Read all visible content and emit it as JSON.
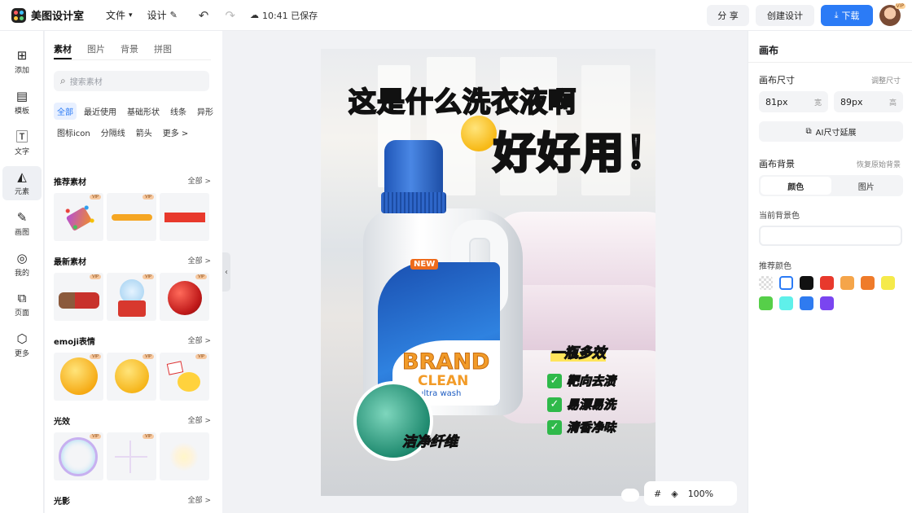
{
  "header": {
    "app_name": "美图设计室",
    "menu_file": "文件",
    "menu_design": "设计",
    "saved_status": "10:41 已保存",
    "share_label": "分 享",
    "create_label": "创建设计",
    "download_label": "下载",
    "avatar_badge": "VIP"
  },
  "rail": {
    "items": [
      {
        "label": "添加",
        "icon": "plus-square-icon"
      },
      {
        "label": "模板",
        "icon": "template-icon"
      },
      {
        "label": "文字",
        "icon": "text-icon"
      },
      {
        "label": "元素",
        "icon": "shapes-icon"
      },
      {
        "label": "画图",
        "icon": "edit-icon"
      },
      {
        "label": "我的",
        "icon": "user-icon"
      },
      {
        "label": "页面",
        "icon": "add-page-icon"
      },
      {
        "label": "更多",
        "icon": "cube-icon"
      }
    ],
    "active_index": 3
  },
  "panel": {
    "tabs": [
      "素材",
      "图片",
      "背景",
      "拼图"
    ],
    "search_placeholder": "搜索素材",
    "chips": [
      "全部",
      "最近使用",
      "基础形状",
      "线条",
      "异形",
      "图标icon",
      "分隔线",
      "箭头",
      "更多 >"
    ],
    "sections": [
      {
        "title": "推荐素材",
        "more": "全部 >"
      },
      {
        "title": "最新素材",
        "more": "全部 >"
      },
      {
        "title": "emoji表情",
        "more": "全部 >"
      },
      {
        "title": "光效",
        "more": "全部 >"
      },
      {
        "title": "光影",
        "more": "全部 >"
      }
    ],
    "vip_badge": "VIP"
  },
  "poster": {
    "headline": "这是什么洗衣液啊",
    "subheadline": "好好用！",
    "new_tag": "NEW",
    "brand": "BRAND",
    "clean": "CLEAN",
    "ultra": "ultra wash",
    "fiber_label": "洁净纤维",
    "multi_effect": "一瓶多效",
    "features": [
      "靶向去渍",
      "易漂易洗",
      "清香净味"
    ]
  },
  "zoom": {
    "grid_icon": "#",
    "level": "100%"
  },
  "right_panel": {
    "title": "画布",
    "size_label": "画布尺寸",
    "resize_link": "调整尺寸",
    "width_value": "81px",
    "width_unit": "宽",
    "height_value": "89px",
    "height_unit": "高",
    "ai_extend": "AI尺寸延展",
    "bg_label": "画布背景",
    "restore_link": "恢复原始背景",
    "seg_color": "颜色",
    "seg_image": "图片",
    "current_bg": "当前背景色",
    "recommended": "推荐颜色",
    "swatch_colors": [
      "transparent",
      "#ffffff",
      "#111111",
      "#e8392c",
      "#f5a54a",
      "#ef7b2a",
      "#f5ea4a",
      "#56cf49",
      "#5ff0ea",
      "#2f7bf0",
      "#7a45f0"
    ]
  }
}
